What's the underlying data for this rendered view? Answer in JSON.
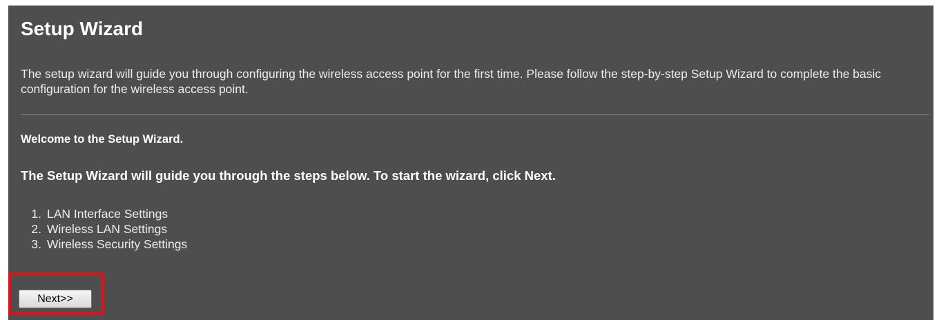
{
  "page": {
    "title": "Setup Wizard",
    "description": "The setup wizard will guide you through configuring the wireless access point for the first time. Please follow the step-by-step Setup Wizard to complete the basic configuration for the wireless access point.",
    "welcome": "Welcome to the Setup Wizard.",
    "intro": "The Setup Wizard will guide you through the steps below. To start the wizard, click Next.",
    "steps": [
      {
        "num": "1.",
        "label": "LAN Interface Settings"
      },
      {
        "num": "2.",
        "label": "Wireless LAN Settings"
      },
      {
        "num": "3.",
        "label": "Wireless Security Settings"
      }
    ],
    "next_label": "Next>>"
  },
  "colors": {
    "panel_background": "#4e4e4e",
    "highlight": "#e3101a"
  }
}
